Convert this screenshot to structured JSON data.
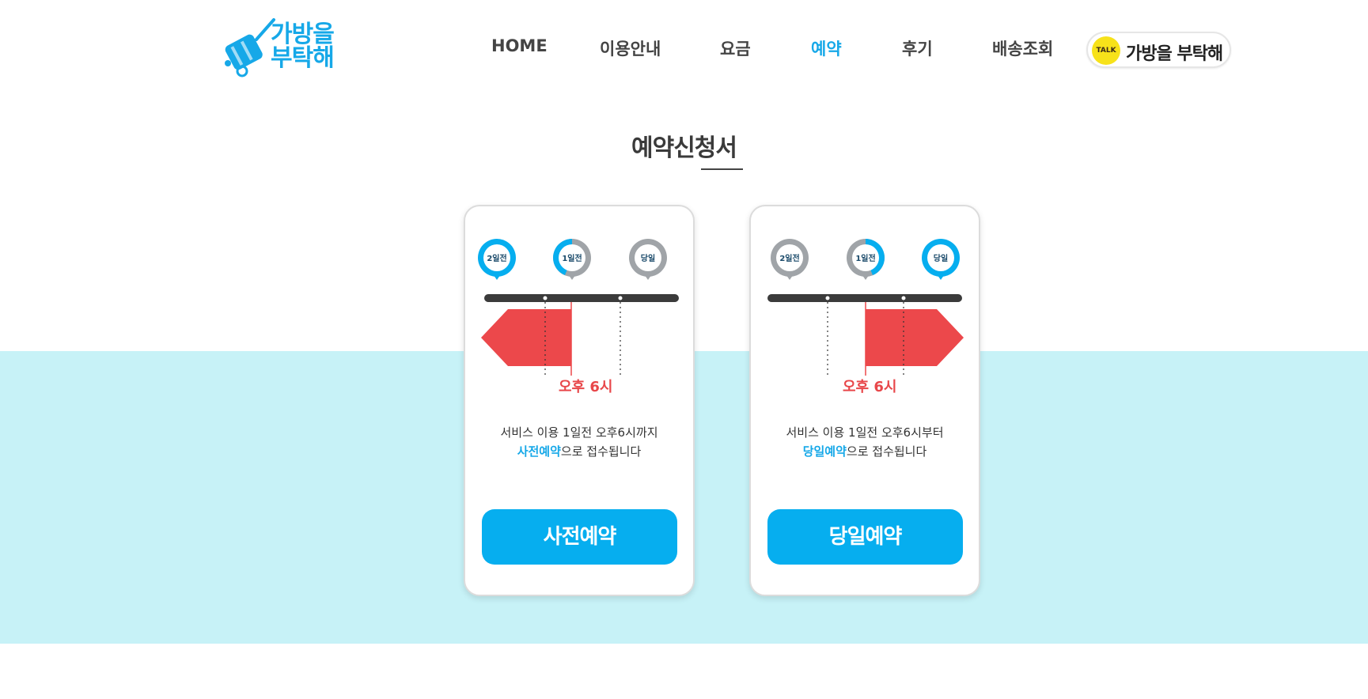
{
  "brand": {
    "line1": "가방을",
    "line2": "부탁해",
    "color": "#16a8e8"
  },
  "nav": {
    "items": [
      {
        "label": "HOME"
      },
      {
        "label": "이용안내"
      },
      {
        "label": "요금"
      },
      {
        "label": "예약",
        "active": true
      },
      {
        "label": "후기"
      },
      {
        "label": "배송조회"
      }
    ]
  },
  "kakao": {
    "badge": "TALK",
    "label": "가방을 부탁해"
  },
  "page": {
    "title": "예약신청서"
  },
  "cards": {
    "advance": {
      "markers": [
        "2일전",
        "1일전",
        "당일"
      ],
      "deadline": "오후 6시",
      "desc_line1": "서비스 이용 1일전 오후6시까지",
      "desc_hl": "사전예약",
      "desc_rest": "으로 접수됩니다",
      "button": "사전예약"
    },
    "sameday": {
      "markers": [
        "2일전",
        "1일전",
        "당일"
      ],
      "deadline": "오후 6시",
      "desc_line1": "서비스 이용 1일전 오후6시부터",
      "desc_hl": "당일예약",
      "desc_rest": "으로 접수됩니다",
      "button": "당일예약"
    }
  },
  "colors": {
    "accent": "#16a8e8",
    "button": "#06aeef",
    "deadline": "#e8474a",
    "band": "#c7f2f7",
    "marker_inactive": "#a0a4a8",
    "kakao_yellow": "#f7e21a"
  }
}
